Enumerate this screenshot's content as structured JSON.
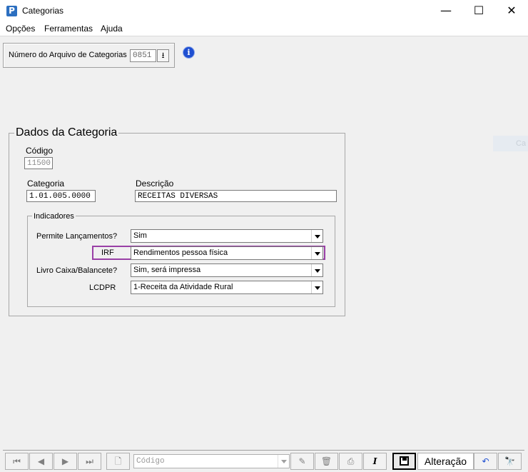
{
  "window": {
    "title": "Categorias",
    "app_icon_glyph": "P",
    "minimize_glyph": "—",
    "maximize_glyph": "☐",
    "close_glyph": "✕"
  },
  "menu": {
    "items": [
      {
        "label": "Opções"
      },
      {
        "label": "Ferramentas"
      },
      {
        "label": "Ajuda"
      }
    ]
  },
  "file": {
    "label": "Número do Arquivo de Categorias",
    "value": "0851",
    "button_glyph": "⭳",
    "info_glyph": "i"
  },
  "ghost_tab": "Ca",
  "category": {
    "group_title": "Dados da Categoria",
    "codigo_label": "Código",
    "codigo_value": "11500",
    "categoria_label": "Categoria",
    "categoria_value": "1.01.005.0000",
    "descricao_label": "Descrição",
    "descricao_value": "RECEITAS DIVERSAS"
  },
  "indicators": {
    "title": "Indicadores",
    "rows": [
      {
        "label": "Permite Lançamentos?",
        "value": "Sim"
      },
      {
        "label": "IRF",
        "value": "Rendimentos pessoa física"
      },
      {
        "label": "Livro Caixa/Balancete?",
        "value": "Sim, será impressa"
      },
      {
        "label": "LCDPR",
        "value": "1-Receita da Atividade Rural"
      }
    ],
    "highlight_color": "#993fa6"
  },
  "toolbar": {
    "first_glyph": "⏮",
    "prev_glyph": "◀",
    "next_glyph": "▶",
    "last_glyph": "⏭",
    "new_glyph": "🗋",
    "code_placeholder": "Código",
    "edit_glyph": "✎",
    "delete_glyph": "🗑",
    "print_glyph": "⎙",
    "italic_glyph": "I",
    "mode_label": "Alteração",
    "undo_glyph": "↶",
    "find_glyph": "🔭"
  }
}
